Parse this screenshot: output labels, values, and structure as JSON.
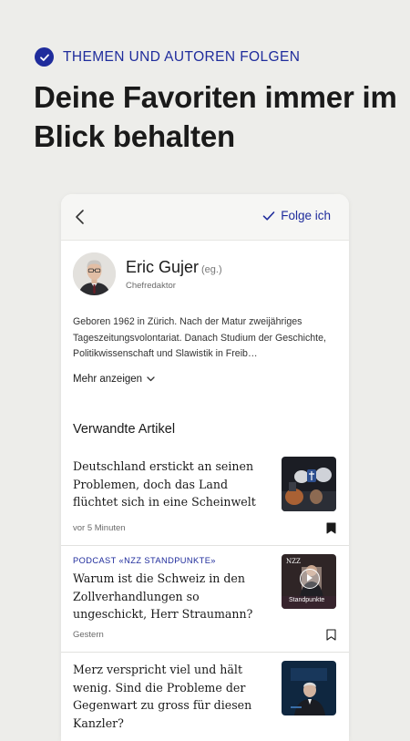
{
  "promo": {
    "badge_label": "THEMEN UND AUTOREN FOLGEN",
    "headline": "Deine Favoriten immer im Blick behalten"
  },
  "topbar": {
    "follow_label": "Folge ich"
  },
  "author": {
    "name": "Eric Gujer",
    "suffix": "(eg.)",
    "role": "Chefredaktor",
    "bio": "Geboren 1962 in Zürich. Nach der Matur zweijähriges Tageszeitungsvolontariat. Danach Studium der Geschichte, Politikwissenschaft und Slawistik in Freib…",
    "more_label": "Mehr anzeigen"
  },
  "related": {
    "title": "Verwandte Artikel",
    "articles": [
      {
        "kicker": "",
        "title": "Deutschland erstickt an seinen Problemen, doch das Land flüchtet sich in eine Scheinwelt",
        "meta": "vor 5 Minuten",
        "bookmarked": true
      },
      {
        "kicker": "PODCAST «NZZ STANDPUNKTE»",
        "title": "Warum ist die Schweiz in den Zollverhandlungen so ungeschickt, Herr Straumann?",
        "meta": "Gestern",
        "thumb_logo": "NZZ",
        "thumb_caption": "Standpunkte",
        "bookmarked": false
      },
      {
        "kicker": "",
        "title": "Merz verspricht viel und hält wenig. Sind die Probleme der Gegenwart zu gross für diesen Kanzler?",
        "meta": "",
        "bookmarked": false
      }
    ]
  },
  "colors": {
    "accent": "#1f2c9c",
    "background": "#ededea",
    "text": "#1a1a1a"
  }
}
